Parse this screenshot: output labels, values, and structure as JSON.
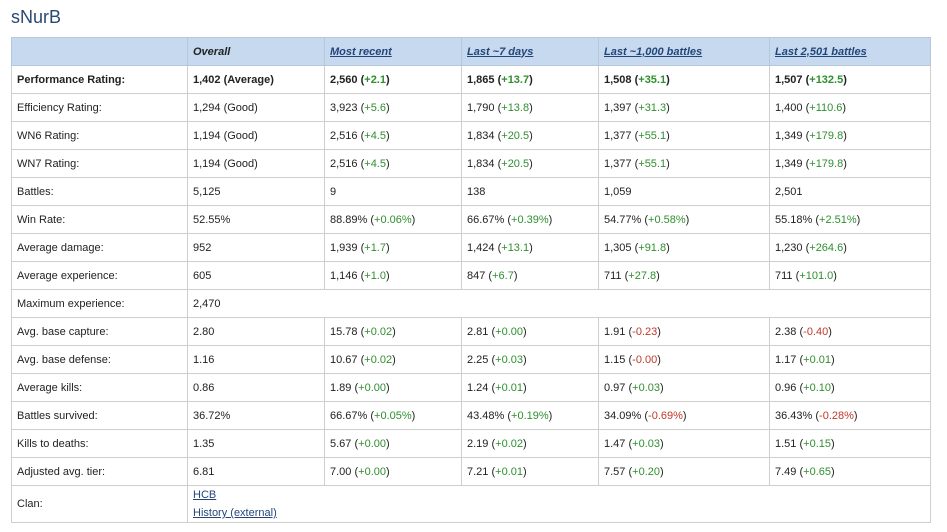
{
  "player_name": "sNurB",
  "headers": [
    "Overall",
    "Most recent",
    "Last ~7 days",
    "Last ~1,000 battles",
    "Last 2,501 battles"
  ],
  "rows": [
    {
      "label": "Performance Rating:",
      "bold": true,
      "cells": [
        {
          "v": "1,402 (Average)"
        },
        {
          "v": "2,560",
          "d": "+2.1",
          "s": "pos"
        },
        {
          "v": "1,865",
          "d": "+13.7",
          "s": "pos"
        },
        {
          "v": "1,508",
          "d": "+35.1",
          "s": "pos"
        },
        {
          "v": "1,507",
          "d": "+132.5",
          "s": "pos"
        }
      ]
    },
    {
      "label": "Efficiency Rating:",
      "cells": [
        {
          "v": "1,294 (Good)"
        },
        {
          "v": "3,923",
          "d": "+5.6",
          "s": "pos"
        },
        {
          "v": "1,790",
          "d": "+13.8",
          "s": "pos"
        },
        {
          "v": "1,397",
          "d": "+31.3",
          "s": "pos"
        },
        {
          "v": "1,400",
          "d": "+110.6",
          "s": "pos"
        }
      ]
    },
    {
      "label": "WN6 Rating:",
      "cells": [
        {
          "v": "1,194 (Good)"
        },
        {
          "v": "2,516",
          "d": "+4.5",
          "s": "pos"
        },
        {
          "v": "1,834",
          "d": "+20.5",
          "s": "pos"
        },
        {
          "v": "1,377",
          "d": "+55.1",
          "s": "pos"
        },
        {
          "v": "1,349",
          "d": "+179.8",
          "s": "pos"
        }
      ]
    },
    {
      "label": "WN7 Rating:",
      "cells": [
        {
          "v": "1,194 (Good)"
        },
        {
          "v": "2,516",
          "d": "+4.5",
          "s": "pos"
        },
        {
          "v": "1,834",
          "d": "+20.5",
          "s": "pos"
        },
        {
          "v": "1,377",
          "d": "+55.1",
          "s": "pos"
        },
        {
          "v": "1,349",
          "d": "+179.8",
          "s": "pos"
        }
      ]
    },
    {
      "label": "Battles:",
      "cells": [
        {
          "v": "5,125"
        },
        {
          "v": "9"
        },
        {
          "v": "138"
        },
        {
          "v": "1,059"
        },
        {
          "v": "2,501"
        }
      ]
    },
    {
      "label": "Win Rate:",
      "cells": [
        {
          "v": "52.55%"
        },
        {
          "v": "88.89%",
          "d": "+0.06%",
          "s": "pos"
        },
        {
          "v": "66.67%",
          "d": "+0.39%",
          "s": "pos"
        },
        {
          "v": "54.77%",
          "d": "+0.58%",
          "s": "pos"
        },
        {
          "v": "55.18%",
          "d": "+2.51%",
          "s": "pos"
        }
      ]
    },
    {
      "label": "Average damage:",
      "cells": [
        {
          "v": "952"
        },
        {
          "v": "1,939",
          "d": "+1.7",
          "s": "pos"
        },
        {
          "v": "1,424",
          "d": "+13.1",
          "s": "pos"
        },
        {
          "v": "1,305",
          "d": "+91.8",
          "s": "pos"
        },
        {
          "v": "1,230",
          "d": "+264.6",
          "s": "pos"
        }
      ]
    },
    {
      "label": "Average experience:",
      "cells": [
        {
          "v": "605"
        },
        {
          "v": "1,146",
          "d": "+1.0",
          "s": "pos"
        },
        {
          "v": "847",
          "d": "+6.7",
          "s": "pos"
        },
        {
          "v": "711",
          "d": "+27.8",
          "s": "pos"
        },
        {
          "v": "711",
          "d": "+101.0",
          "s": "pos"
        }
      ]
    },
    {
      "label": "Maximum experience:",
      "span": true,
      "cells": [
        {
          "v": "2,470"
        }
      ]
    },
    {
      "label": "Avg. base capture:",
      "cells": [
        {
          "v": "2.80"
        },
        {
          "v": "15.78",
          "d": "+0.02",
          "s": "pos"
        },
        {
          "v": "2.81",
          "d": "+0.00",
          "s": "pos"
        },
        {
          "v": "1.91",
          "d": "-0.23",
          "s": "neg"
        },
        {
          "v": "2.38",
          "d": "-0.40",
          "s": "neg"
        }
      ]
    },
    {
      "label": "Avg. base defense:",
      "cells": [
        {
          "v": "1.16"
        },
        {
          "v": "10.67",
          "d": "+0.02",
          "s": "pos"
        },
        {
          "v": "2.25",
          "d": "+0.03",
          "s": "pos"
        },
        {
          "v": "1.15",
          "d": "-0.00",
          "s": "neg"
        },
        {
          "v": "1.17",
          "d": "+0.01",
          "s": "pos"
        }
      ]
    },
    {
      "label": "Average kills:",
      "cells": [
        {
          "v": "0.86"
        },
        {
          "v": "1.89",
          "d": "+0.00",
          "s": "pos"
        },
        {
          "v": "1.24",
          "d": "+0.01",
          "s": "pos"
        },
        {
          "v": "0.97",
          "d": "+0.03",
          "s": "pos"
        },
        {
          "v": "0.96",
          "d": "+0.10",
          "s": "pos"
        }
      ]
    },
    {
      "label": "Battles survived:",
      "cells": [
        {
          "v": "36.72%"
        },
        {
          "v": "66.67%",
          "d": "+0.05%",
          "s": "pos"
        },
        {
          "v": "43.48%",
          "d": "+0.19%",
          "s": "pos"
        },
        {
          "v": "34.09%",
          "d": "-0.69%",
          "s": "neg"
        },
        {
          "v": "36.43%",
          "d": "-0.28%",
          "s": "neg"
        }
      ]
    },
    {
      "label": "Kills to deaths:",
      "cells": [
        {
          "v": "1.35"
        },
        {
          "v": "5.67",
          "d": "+0.00",
          "s": "pos"
        },
        {
          "v": "2.19",
          "d": "+0.02",
          "s": "pos"
        },
        {
          "v": "1.47",
          "d": "+0.03",
          "s": "pos"
        },
        {
          "v": "1.51",
          "d": "+0.15",
          "s": "pos"
        }
      ]
    },
    {
      "label": "Adjusted avg. tier:",
      "cells": [
        {
          "v": "6.81"
        },
        {
          "v": "7.00",
          "d": "+0.00",
          "s": "pos"
        },
        {
          "v": "7.21",
          "d": "+0.01",
          "s": "pos"
        },
        {
          "v": "7.57",
          "d": "+0.20",
          "s": "pos"
        },
        {
          "v": "7.49",
          "d": "+0.65",
          "s": "pos"
        }
      ]
    }
  ],
  "clan": {
    "label": "Clan:",
    "links": [
      "HCB",
      "History (external)"
    ]
  },
  "colors": {
    "header_bg": "#c6d9ef",
    "link": "#23467a",
    "positive": "#2f8f2f",
    "negative": "#c0392b",
    "title": "#2b4a73"
  }
}
